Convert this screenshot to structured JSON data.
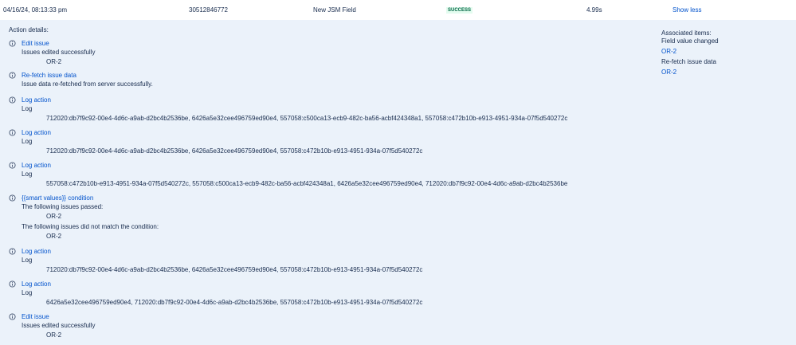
{
  "row": {
    "date": "04/16/24, 08:13:33 pm",
    "id": "30512846772",
    "rule": "New JSM Field",
    "status": "SUCCESS",
    "duration": "4.99s",
    "toggle": "Show less"
  },
  "details": {
    "title": "Action details:",
    "entries": [
      {
        "title": "Edit issue",
        "lines": [
          "Issues edited successfully"
        ],
        "indented": [
          "OR-2"
        ]
      },
      {
        "title": "Re-fetch issue data",
        "lines": [
          "Issue data re-fetched from server successfully."
        ],
        "indented": []
      },
      {
        "title": "Log action",
        "lines": [
          "Log"
        ],
        "indented": [
          "712020:db7f9c92-00e4-4d6c-a9ab-d2bc4b2536be, 6426a5e32cee496759ed90e4, 557058:c500ca13-ecb9-482c-ba56-acbf424348a1, 557058:c472b10b-e913-4951-934a-07f5d540272c"
        ]
      },
      {
        "title": "Log action",
        "lines": [
          "Log"
        ],
        "indented": [
          "712020:db7f9c92-00e4-4d6c-a9ab-d2bc4b2536be, 6426a5e32cee496759ed90e4, 557058:c472b10b-e913-4951-934a-07f5d540272c"
        ]
      },
      {
        "title": "Log action",
        "lines": [
          "Log"
        ],
        "indented": [
          "557058:c472b10b-e913-4951-934a-07f5d540272c, 557058:c500ca13-ecb9-482c-ba56-acbf424348a1, 6426a5e32cee496759ed90e4, 712020:db7f9c92-00e4-4d6c-a9ab-d2bc4b2536be"
        ]
      },
      {
        "title": "{{smart values}} condition",
        "lines": [
          "The following issues passed:",
          "The following issues did not match the condition:"
        ],
        "indented": [
          "OR-2",
          "OR-2"
        ]
      },
      {
        "title": "Log action",
        "lines": [
          "Log"
        ],
        "indented": [
          "712020:db7f9c92-00e4-4d6c-a9ab-d2bc4b2536be, 6426a5e32cee496759ed90e4, 557058:c472b10b-e913-4951-934a-07f5d540272c"
        ]
      },
      {
        "title": "Log action",
        "lines": [
          "Log"
        ],
        "indented": [
          "6426a5e32cee496759ed90e4, 712020:db7f9c92-00e4-4d6c-a9ab-d2bc4b2536be, 557058:c472b10b-e913-4951-934a-07f5d540272c"
        ]
      },
      {
        "title": "Edit issue",
        "lines": [
          "Issues edited successfully"
        ],
        "indented": [
          "OR-2"
        ]
      }
    ]
  },
  "associated": {
    "heading": "Associated items:",
    "items": [
      {
        "label": "Field value changed",
        "issue": "OR-2"
      },
      {
        "label": "Re-fetch issue data",
        "issue": "OR-2"
      }
    ]
  },
  "colors": {
    "link": "#0052cc",
    "panel": "#ebf2fa",
    "status_text": "#006644",
    "status_bg": "#e3fcef"
  },
  "icons": {
    "entry": "info-circle-icon"
  }
}
